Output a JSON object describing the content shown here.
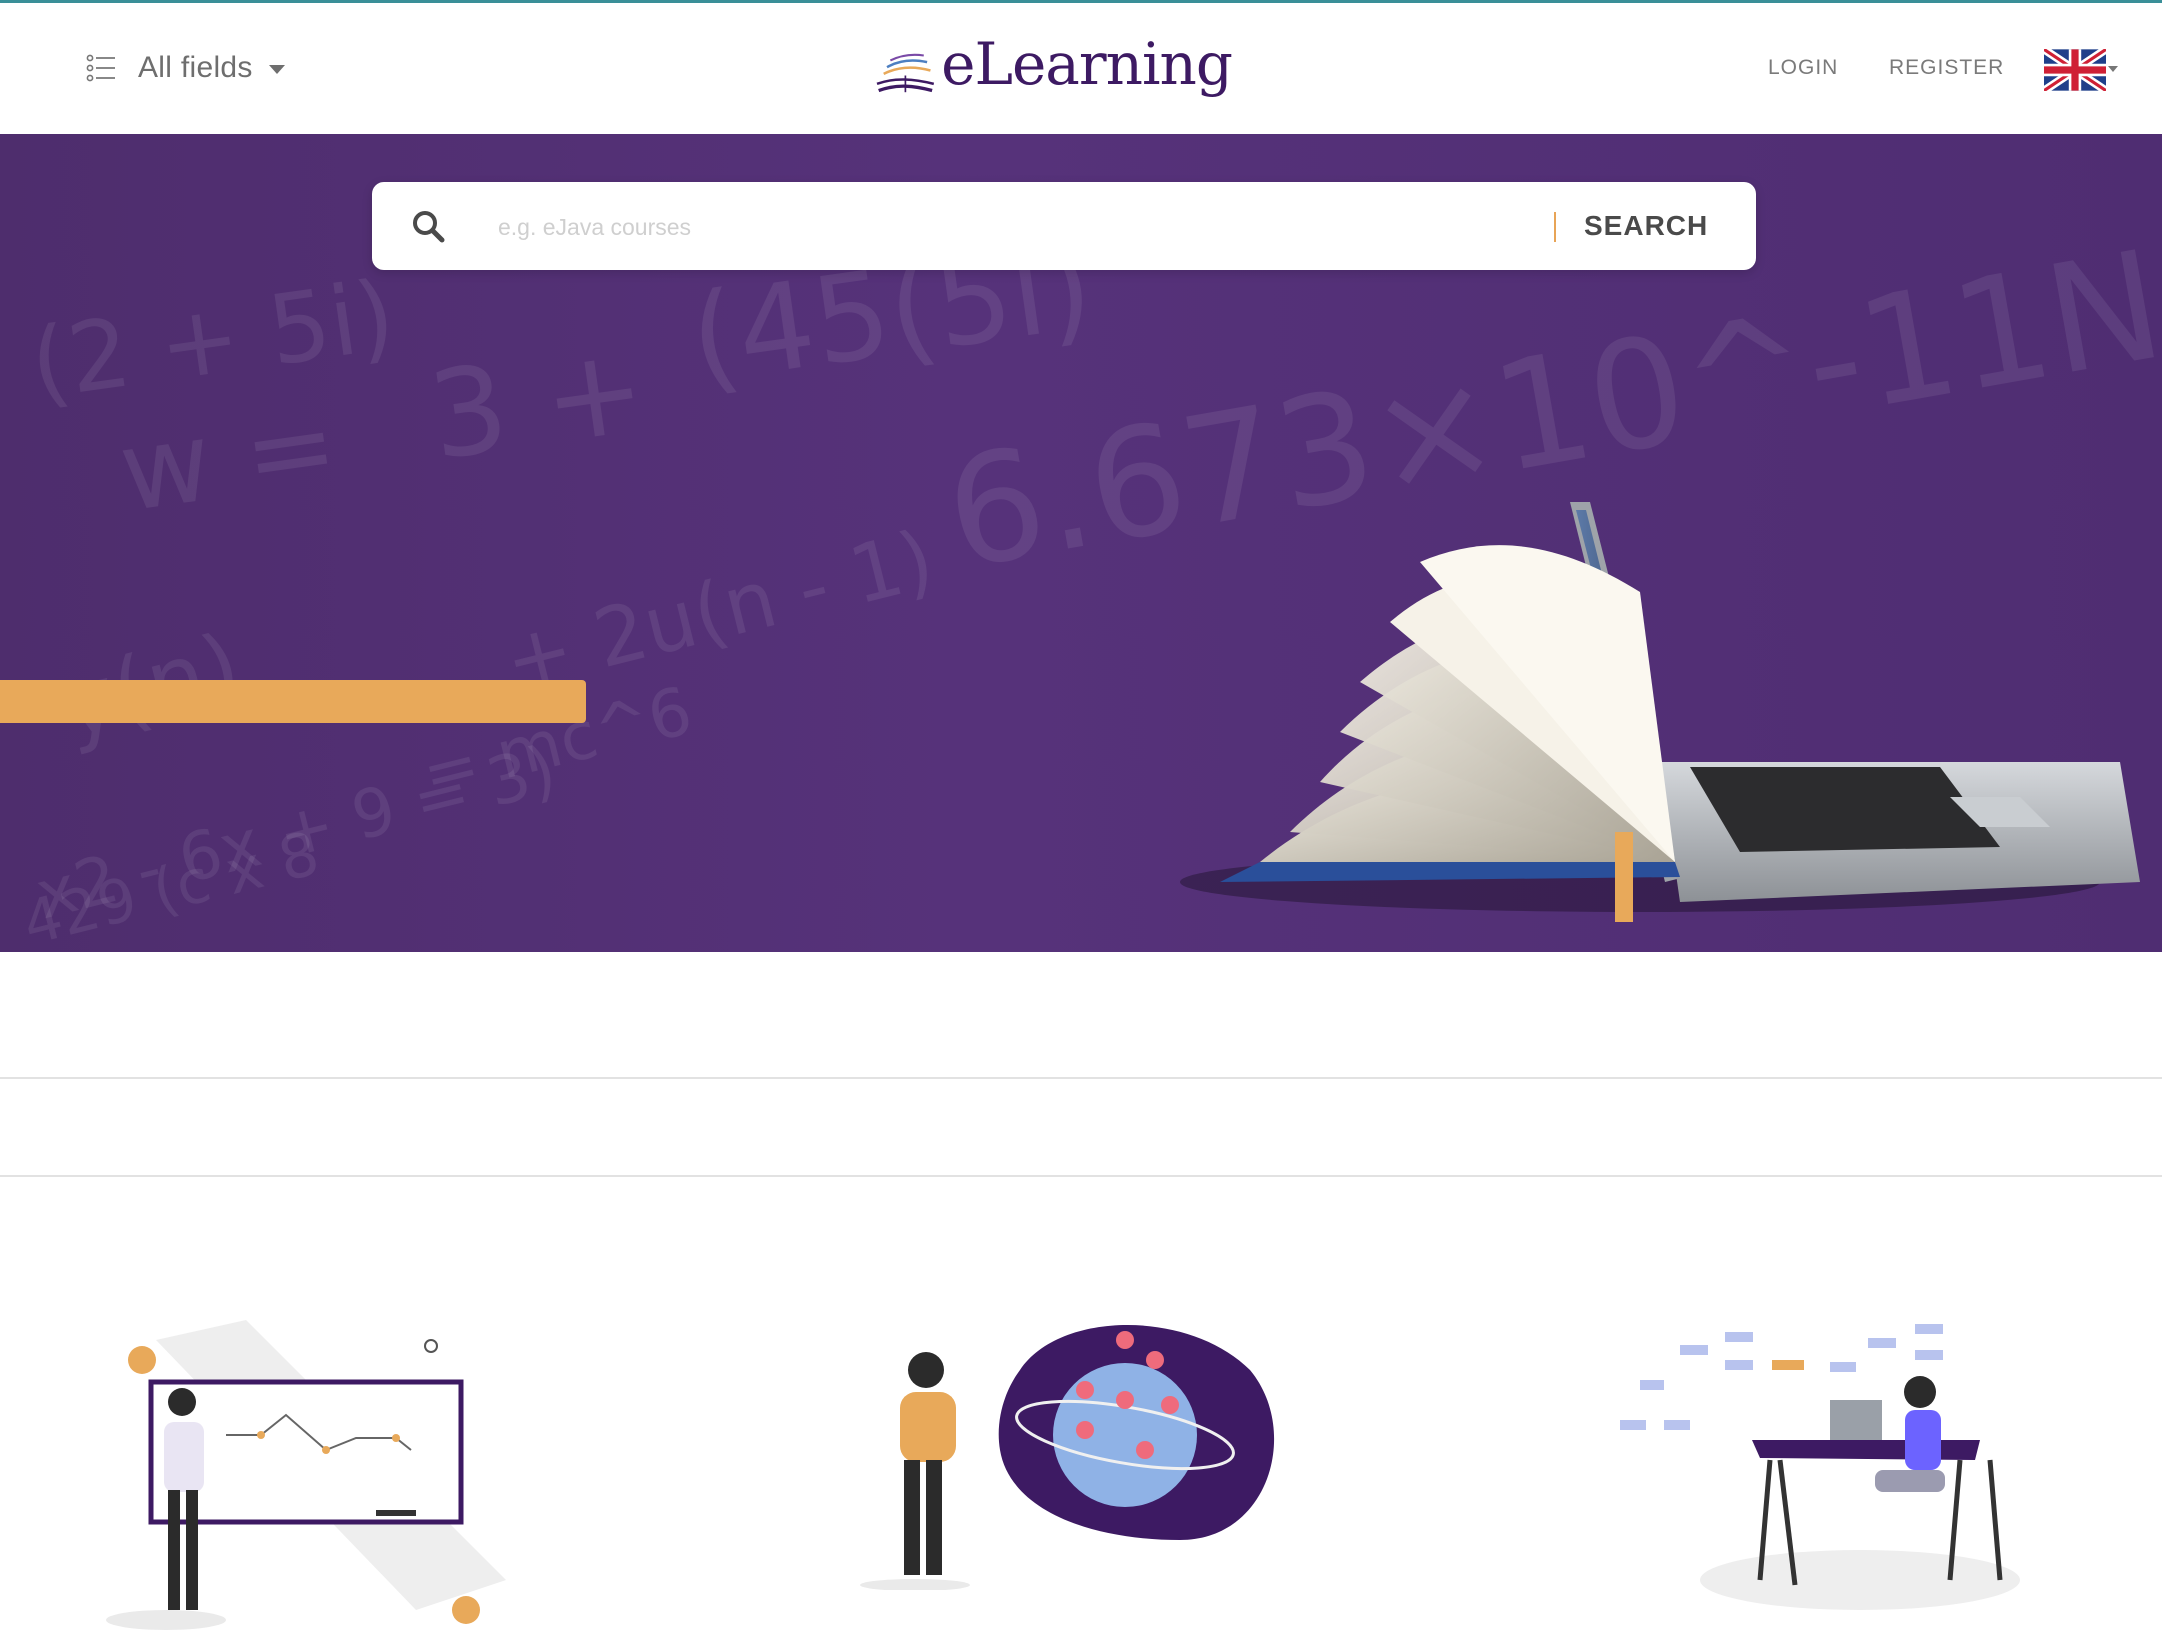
{
  "header": {
    "fields_label": "All fields",
    "logo_text": "eLearning",
    "login_label": "LOGIN",
    "register_label": "REGISTER",
    "language_flag": "uk-flag-icon"
  },
  "hero": {
    "search_placeholder": "e.g. eJava courses",
    "search_button_label": "SEARCH",
    "search_icon": "search-icon",
    "background_text": [
      "(2 + 5i)",
      "w =",
      "3 +",
      "(45(5i)",
      "6.673×10^-11N",
      "+ 2u(n - 1)",
      "y(n)",
      "= mc^6",
      "x2 - 6x + 9 = 3)",
      "429 (c x 8"
    ]
  },
  "illustrations": [
    {
      "name": "presentation-illustration"
    },
    {
      "name": "globe-illustration"
    },
    {
      "name": "desk-illustration"
    }
  ],
  "colors": {
    "accent": "#e8a95a",
    "brand_purple": "#3d1a63",
    "hero_purple": "#56327a",
    "top_line": "#3a8f98"
  }
}
